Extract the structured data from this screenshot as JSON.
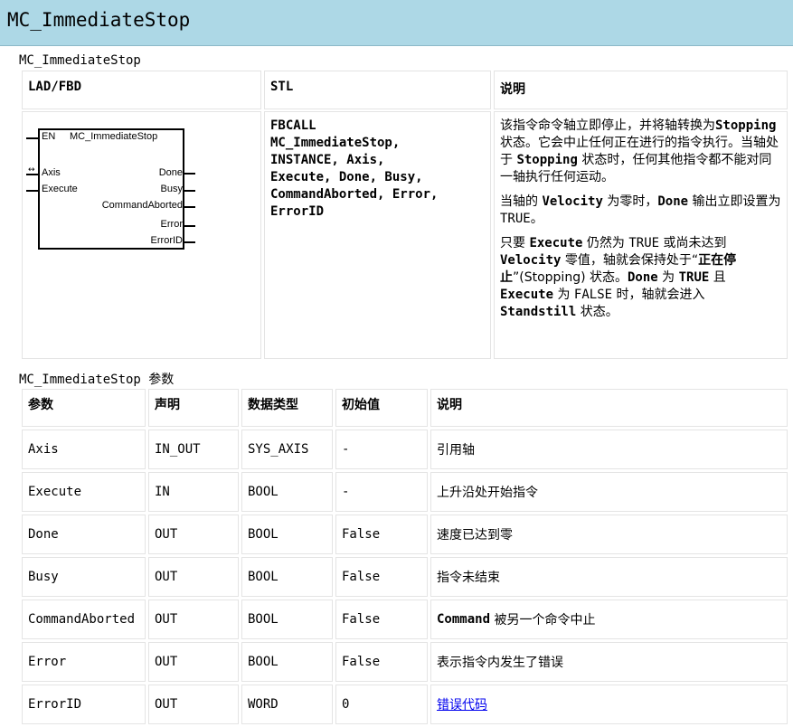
{
  "page": {
    "title": "MC_ImmediateStop"
  },
  "overview": {
    "caption": "MC_ImmediateStop",
    "headers": [
      "LAD/FBD",
      "STL",
      "说明"
    ],
    "fbd": {
      "block_name": "MC_ImmediateStop",
      "en": "EN",
      "inputs": [
        "Axis",
        "Execute"
      ],
      "outputs": [
        "Done",
        "Busy",
        "CommandAborted",
        "Error",
        "ErrorID"
      ]
    },
    "stl_lines": [
      "FBCALL",
      "MC_ImmediateStop,",
      "INSTANCE, Axis,",
      "Execute, Done, Busy,",
      "CommandAborted, Error,",
      "ErrorID"
    ],
    "desc": {
      "p1_a": "该指令命令轴立即停止，并将轴转换为",
      "p1_b": "Stopping",
      "p1_c": " 状态。它会中止任何正在进行的指令执行。当轴处于 ",
      "p1_d": "Stopping",
      "p1_e": " 状态时，任何其他指令都不能对同一轴执行任何运动。",
      "p2_a": "当轴的 ",
      "p2_b": "Velocity",
      "p2_c": " 为零时，",
      "p2_d": "Done",
      "p2_e": " 输出立即设置为 ",
      "p2_f": "TRUE",
      "p2_g": "。",
      "p3_a": "只要 ",
      "p3_b": "Execute",
      "p3_c": " 仍然为 ",
      "p3_d": "TRUE",
      "p3_e": " 或尚未达到 ",
      "p3_f": "Velocity",
      "p3_g": " 零值，轴就会保持处于“",
      "p3_h": "正在停止",
      "p3_i": "”(Stopping) 状态。",
      "p3_j": "Done",
      "p3_k": " 为 ",
      "p3_l": "TRUE",
      "p3_m": " 且 ",
      "p3_n": "Execute",
      "p3_o": " 为 ",
      "p3_p": "FALSE",
      "p3_q": " 时，轴就会进入 ",
      "p3_r": "Standstill",
      "p3_s": " 状态。"
    }
  },
  "params": {
    "caption": "MC_ImmediateStop 参数",
    "headers": [
      "参数",
      "声明",
      "数据类型",
      "初始值",
      "说明"
    ],
    "rows": [
      {
        "param": "Axis",
        "decl": "IN_OUT",
        "type": "SYS_AXIS",
        "init": "-",
        "desc": "引用轴"
      },
      {
        "param": "Execute",
        "decl": "IN",
        "type": "BOOL",
        "init": "-",
        "desc": "上升沿处开始指令"
      },
      {
        "param": "Done",
        "decl": "OUT",
        "type": "BOOL",
        "init": "False",
        "desc": "速度已达到零"
      },
      {
        "param": "Busy",
        "decl": "OUT",
        "type": "BOOL",
        "init": "False",
        "desc": "指令未结束"
      },
      {
        "param": "CommandAborted",
        "decl": "OUT",
        "type": "BOOL",
        "init": "False",
        "desc_bold": "Command",
        "desc": " 被另一个命令中止"
      },
      {
        "param": "Error",
        "decl": "OUT",
        "type": "BOOL",
        "init": "False",
        "desc": "表示指令内发生了错误"
      },
      {
        "param": "ErrorID",
        "decl": "OUT",
        "type": "WORD",
        "init": "0",
        "desc_link": "错误代码"
      }
    ]
  }
}
